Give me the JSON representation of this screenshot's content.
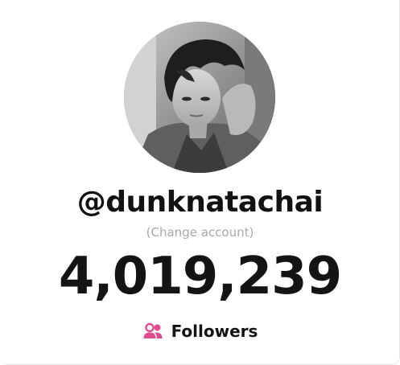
{
  "profile": {
    "username": "@dunknatachai",
    "change_account_label": "(Change account)",
    "avatar_icon": "profile-photo",
    "avatar_alt": "dunknatachai profile photo"
  },
  "stats": {
    "follower_count": "4,019,239",
    "followers_label": "Followers",
    "followers_icon": "users-icon",
    "followers_icon_color": "#e24b8f"
  }
}
